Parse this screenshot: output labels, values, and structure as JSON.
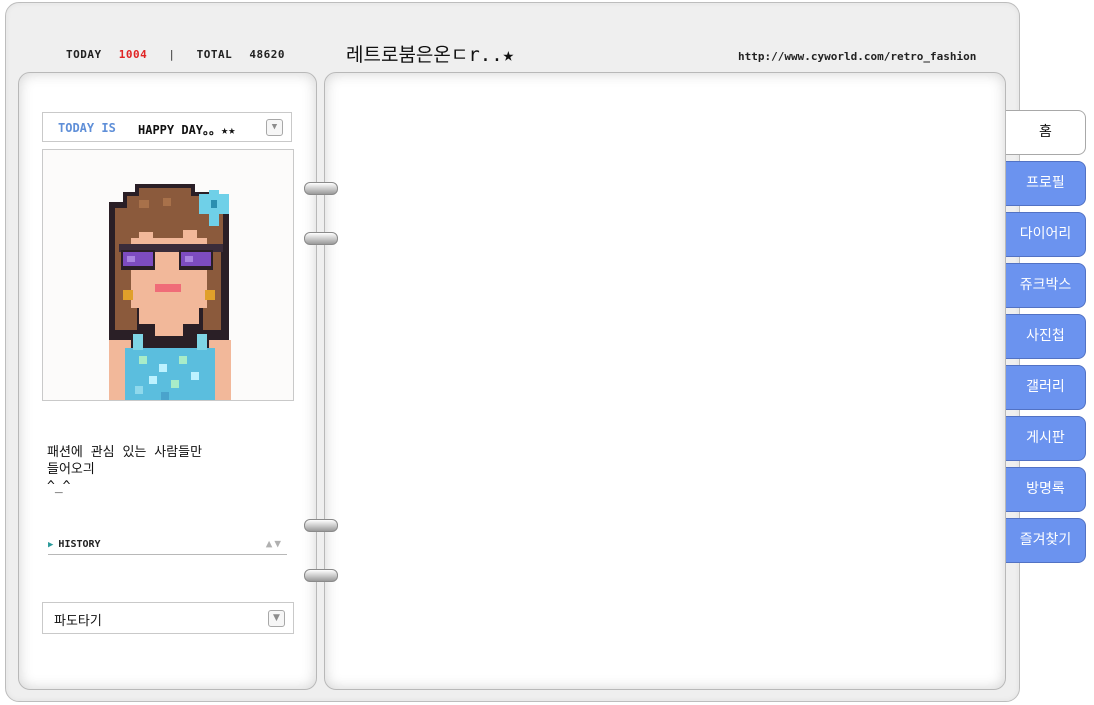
{
  "header": {
    "today_label": "TODAY",
    "today_count": "1004",
    "separator": "|",
    "total_label": "TOTAL",
    "total_count": "48620",
    "title": "레트로붐은온ㄷr..★",
    "url": "http://www.cyworld.com/retro_fashion"
  },
  "profile": {
    "today_is_label": "TODAY IS",
    "mood": "HAPPY DAY。。★★",
    "mood_dropdown_icon": "▼",
    "intro_lines": [
      "패션에 관심 있는 사람들만",
      "들어오긔",
      "^_^"
    ],
    "history_label": "HISTORY",
    "history_marker": "▶",
    "history_arrows": "▲▼",
    "pado_label": "파도타기",
    "pado_dropdown_icon": "▼"
  },
  "tabs": [
    {
      "label": "홈",
      "active": true
    },
    {
      "label": "프로필",
      "active": false
    },
    {
      "label": "다이어리",
      "active": false
    },
    {
      "label": "쥬크박스",
      "active": false
    },
    {
      "label": "사진첩",
      "active": false
    },
    {
      "label": "갤러리",
      "active": false
    },
    {
      "label": "게시판",
      "active": false
    },
    {
      "label": "방명록",
      "active": false
    },
    {
      "label": "즐겨찾기",
      "active": false
    }
  ],
  "colors": {
    "tab_blue": "#6b93ef",
    "today_count_red": "#e02424",
    "today_is_blue": "#5f8fd8"
  }
}
